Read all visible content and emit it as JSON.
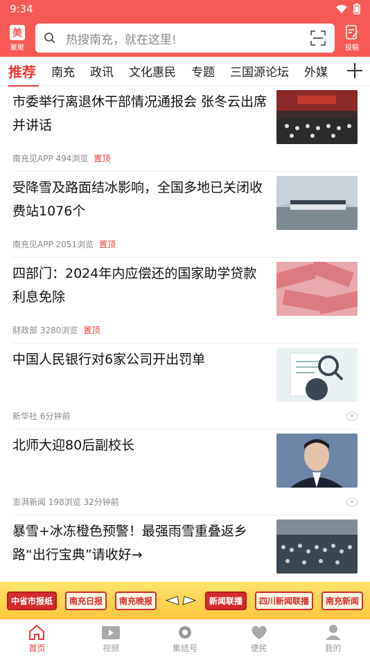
{
  "status": {
    "time": "9:34"
  },
  "header": {
    "logo_label": "聚聚",
    "logo_mark": "美",
    "search_placeholder": "热搜南充，就在这里!",
    "post_label": "投稿"
  },
  "tabs": [
    "推荐",
    "南充",
    "政讯",
    "文化惠民",
    "专题",
    "三国源论坛",
    "外媒"
  ],
  "news": [
    {
      "title": "市委举行离退休干部情况通报会 张冬云出席并讲话",
      "meta": "南充见APP 494浏览",
      "tag": "置顶"
    },
    {
      "title": "受降雪及路面结冰影响，全国多地已关闭收费站1076个",
      "meta": "南充见APP 2051浏览",
      "tag": "置顶"
    },
    {
      "title": "四部门：2024年内应偿还的国家助学贷款利息免除",
      "meta": "财政部 3280浏览",
      "tag": "置顶"
    },
    {
      "title": "中国人民银行对6家公司开出罚单",
      "meta": "新华社 6分钟前",
      "tag": ""
    },
    {
      "title": "北师大迎80后副校长",
      "meta": "澎湃新闻 198浏览 32分钟前",
      "tag": ""
    },
    {
      "title": "暴雪+冰冻橙色预警！最强雨雪重叠返乡路“出行宝典”请收好→",
      "meta": "",
      "tag": ""
    }
  ],
  "banner": [
    "中省市报纸",
    "南充日报",
    "南充晚报",
    "新闻联播",
    "四川新闻联播",
    "南充新闻"
  ],
  "nav": [
    "首页",
    "视频",
    "集结号",
    "便民",
    "我的"
  ],
  "colors": {
    "brand": "#f75a55",
    "accent": "#e63c35"
  }
}
